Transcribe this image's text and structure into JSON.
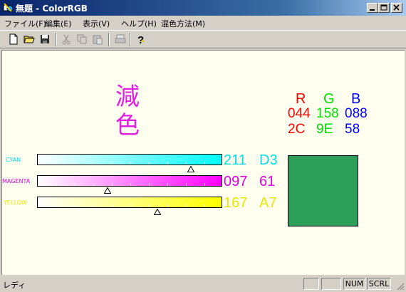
{
  "window": {
    "title": "無題 - ColorRGB"
  },
  "menu": [
    "ファイル(F)",
    "編集(E)",
    "表示(V)",
    "ヘルプ(H)",
    "混色方法(M)"
  ],
  "heading": {
    "line1": "減",
    "line2": "色"
  },
  "rgb": {
    "headers": [
      {
        "label": "R",
        "color": "#ff0000"
      },
      {
        "label": "G",
        "color": "#00e000"
      },
      {
        "label": "B",
        "color": "#0000ff"
      }
    ],
    "decimal": [
      "044",
      "158",
      "088"
    ],
    "hex": [
      "2C",
      "9E",
      "58"
    ]
  },
  "bars": [
    {
      "label": "CYAN",
      "color": "#00e0e0",
      "fill_end": "#00ffff",
      "value_dec": "211",
      "value_hex": "D3",
      "level": 0.83
    },
    {
      "label": "MAGENTA",
      "color": "#e000e0",
      "fill_end": "#ff00ff",
      "value_dec": "097",
      "value_hex": "61",
      "level": 0.38
    },
    {
      "label": "YELLOW",
      "color": "#e8e800",
      "fill_end": "#ffff00",
      "value_dec": "167",
      "value_hex": "A7",
      "level": 0.65
    }
  ],
  "swatch_color": "#2c9e58",
  "status": {
    "text": "レディ",
    "panels": [
      "",
      "",
      "NUM",
      "SCRL"
    ]
  }
}
